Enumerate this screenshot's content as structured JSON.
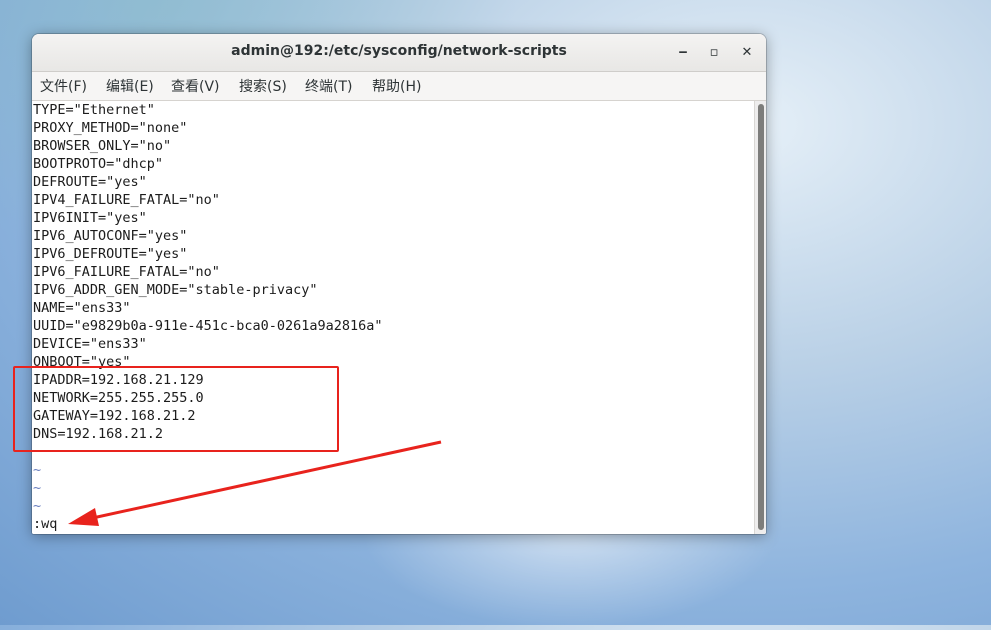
{
  "window": {
    "title": "admin@192:/etc/sysconfig/network-scripts",
    "minimize_glyph": "‒",
    "maximize_glyph": "▫",
    "close_glyph": "✕"
  },
  "menubar": {
    "items": [
      {
        "label": "文件(F)"
      },
      {
        "label": "编辑(E)"
      },
      {
        "label": "查看(V)"
      },
      {
        "label": "搜索(S)"
      },
      {
        "label": "终端(T)"
      },
      {
        "label": "帮助(H)"
      }
    ]
  },
  "terminal": {
    "lines": [
      "TYPE=\"Ethernet\"",
      "PROXY_METHOD=\"none\"",
      "BROWSER_ONLY=\"no\"",
      "BOOTPROTO=\"dhcp\"",
      "DEFROUTE=\"yes\"",
      "IPV4_FAILURE_FATAL=\"no\"",
      "IPV6INIT=\"yes\"",
      "IPV6_AUTOCONF=\"yes\"",
      "IPV6_DEFROUTE=\"yes\"",
      "IPV6_FAILURE_FATAL=\"no\"",
      "IPV6_ADDR_GEN_MODE=\"stable-privacy\"",
      "NAME=\"ens33\"",
      "UUID=\"e9829b0a-911e-451c-bca0-0261a9a2816a\"",
      "DEVICE=\"ens33\"",
      "ONBOOT=\"yes\"",
      "IPADDR=192.168.21.129",
      "NETWORK=255.255.255.0",
      "GATEWAY=192.168.21.2",
      "DNS=192.168.21.2"
    ],
    "tildes": [
      "~",
      "~",
      "~"
    ],
    "command_line": ":wq"
  },
  "colors": {
    "annotation_red": "#e8231d",
    "tilde_blue": "#6a7fbf"
  }
}
